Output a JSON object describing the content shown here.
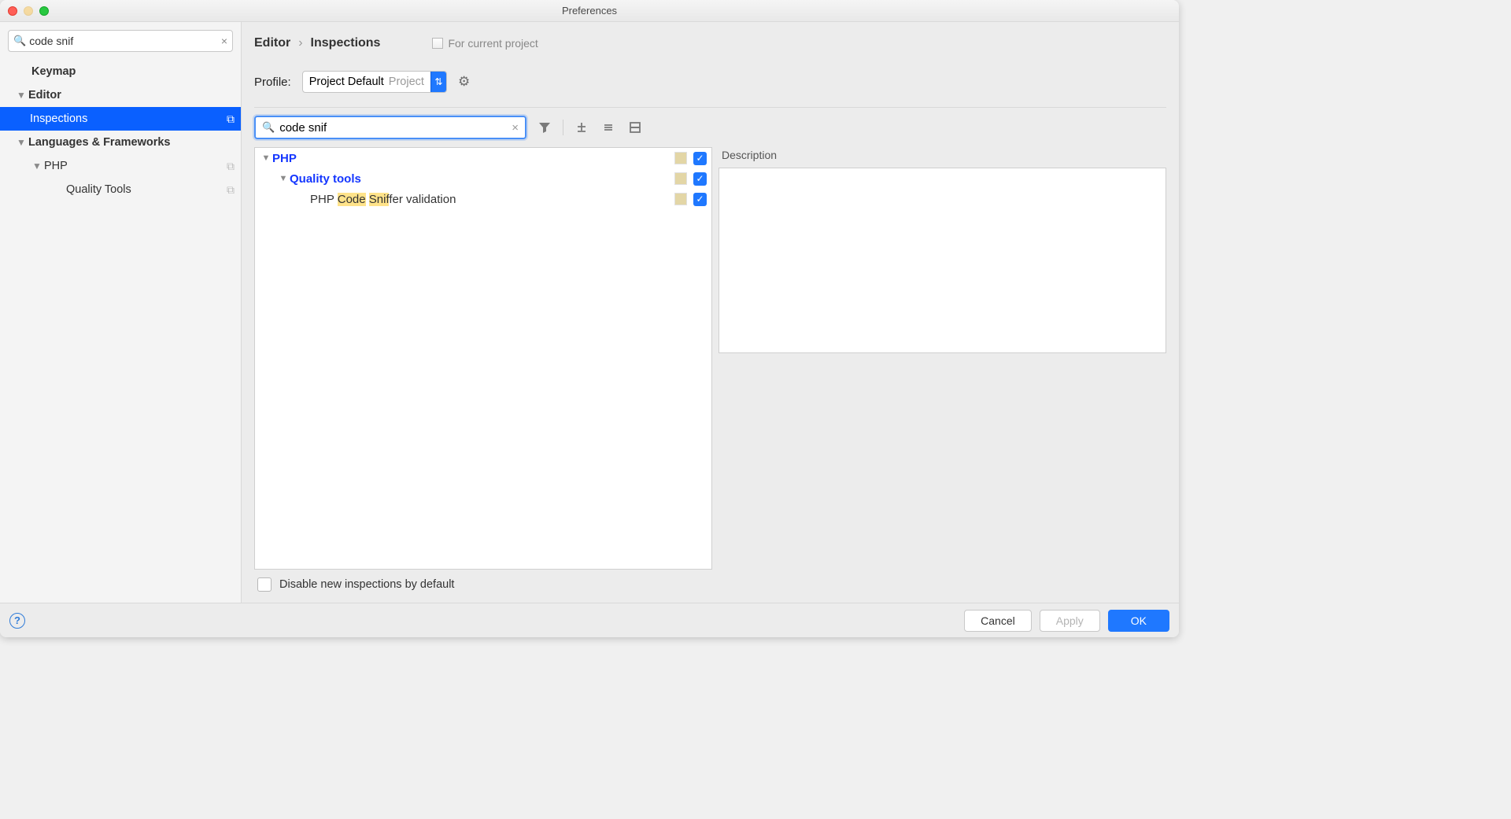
{
  "window": {
    "title": "Preferences"
  },
  "sidebar_search": {
    "value": "code snif"
  },
  "sidebar": {
    "keymap": "Keymap",
    "editor": "Editor",
    "inspections": "Inspections",
    "lang": "Languages & Frameworks",
    "php": "PHP",
    "quality": "Quality Tools"
  },
  "breadcrumb": {
    "a": "Editor",
    "b": "Inspections",
    "scope": "For current project"
  },
  "profile": {
    "label": "Profile:",
    "value": "Project Default",
    "scope": "Project"
  },
  "insp_search": {
    "value": "code snif"
  },
  "tree": {
    "php": "PHP",
    "quality": "Quality tools",
    "entry_prefix": "PHP ",
    "hl1": "Code",
    "hl2": "Snif",
    "entry_suffix": "fer validation"
  },
  "description": {
    "title": "Description"
  },
  "disable_new": "Disable new inspections by default",
  "buttons": {
    "cancel": "Cancel",
    "apply": "Apply",
    "ok": "OK"
  }
}
